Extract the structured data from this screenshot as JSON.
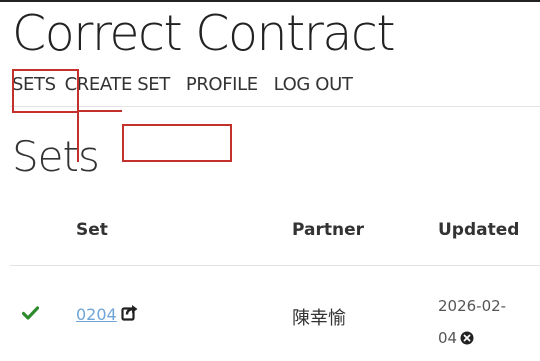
{
  "app": {
    "title": "Correct Contract"
  },
  "nav": {
    "items": [
      {
        "label": "SETS"
      },
      {
        "label": "CREATE SET"
      },
      {
        "label": "PROFILE"
      },
      {
        "label": "LOG OUT"
      }
    ]
  },
  "page": {
    "title": "Sets"
  },
  "table": {
    "headers": {
      "set": "Set",
      "partner": "Partner",
      "updated": "Updated"
    },
    "rows": [
      {
        "status_icon": "check-icon",
        "set": "0204",
        "share_icon": "share-icon",
        "partner": "陳幸愉",
        "updated_line1": "2026-02-",
        "updated_line2": "04",
        "remove_icon": "remove-icon"
      }
    ]
  },
  "colors": {
    "highlight": "#c4302b",
    "check": "#2e8b2e",
    "link": "#6fa5d6",
    "text": "#333333"
  }
}
